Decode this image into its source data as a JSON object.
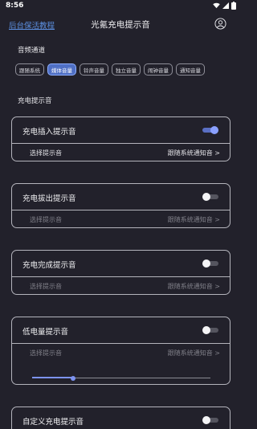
{
  "status_bar": {
    "time": "8:56"
  },
  "header": {
    "link": "后台保活教程",
    "title": "光氪充电提示音",
    "profile_icon": "person-circle-icon"
  },
  "audio_channel": {
    "label": "音频通道",
    "options": [
      "跟随系统",
      "媒体音量",
      "铃声音量",
      "独立音量",
      "闹钟音量",
      "通知音量"
    ],
    "selected": "媒体音量"
  },
  "section_label": "充电提示音",
  "cards": [
    {
      "title": "充电插入提示音",
      "enabled": true,
      "row_label": "选择提示音",
      "row_value": "跟随系统通知音 >"
    },
    {
      "title": "充电拔出提示音",
      "enabled": false,
      "row_label": "选择提示音",
      "row_value": "跟随系统通知音 >"
    },
    {
      "title": "充电完成提示音",
      "enabled": false,
      "row_label": "选择提示音",
      "row_value": "跟随系统通知音 >"
    },
    {
      "title": "低电量提示音",
      "enabled": false,
      "row_label": "选择提示音",
      "row_value": "跟随系统通知音 >",
      "slider_level": 0.23
    },
    {
      "title": "自定义充电提示音",
      "enabled": false
    }
  ],
  "colors": {
    "background": "#22212b",
    "accent": "#7d93f0",
    "link": "#5c8fe0"
  }
}
